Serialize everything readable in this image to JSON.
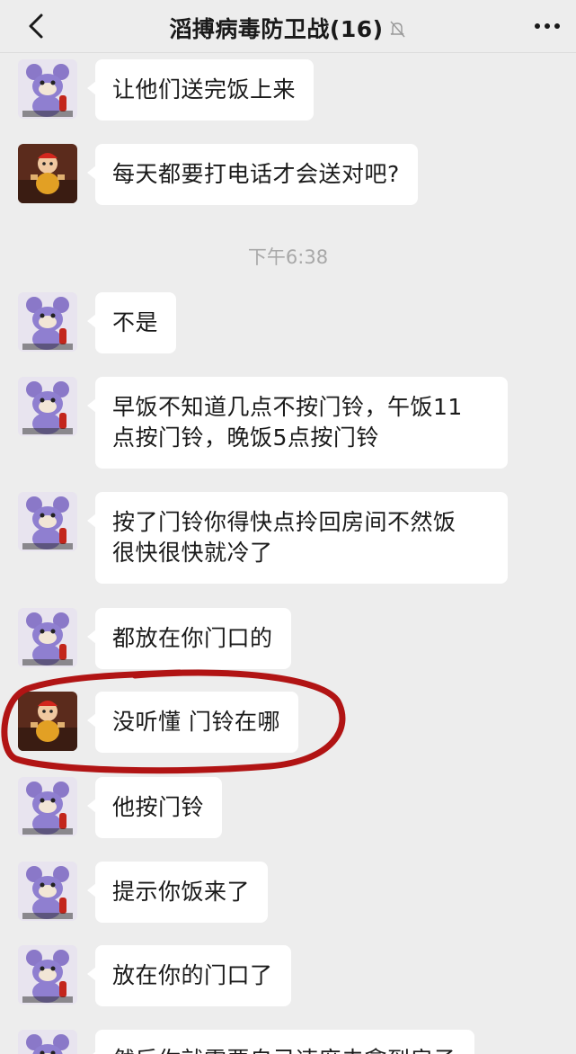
{
  "header": {
    "title": "滔搏病毒防卫战(16)",
    "back_icon": "chevron-left-icon",
    "mute_icon": "bell-off-icon",
    "more_icon": "more-dots-icon"
  },
  "colors": {
    "background": "#ededed",
    "bubble": "#ffffff",
    "annotation_circle": "#b11414"
  },
  "messages": [
    {
      "avatar": "blue-cartoon-avatar",
      "text": "让他们送完饭上来"
    },
    {
      "avatar": "red-cartoon-avatar",
      "text": "每天都要打电话才会送对吧?"
    },
    {
      "avatar": "blue-cartoon-avatar",
      "text": "不是"
    },
    {
      "avatar": "blue-cartoon-avatar",
      "text": "早饭不知道几点不按门铃，午饭11\n点按门铃，晚饭5点按门铃"
    },
    {
      "avatar": "blue-cartoon-avatar",
      "text": "按了门铃你得快点拎回房间不然饭\n很快很快就冷了"
    },
    {
      "avatar": "blue-cartoon-avatar",
      "text": "都放在你门口的"
    },
    {
      "avatar": "red-cartoon-avatar",
      "text": "没听懂 门铃在哪",
      "circled": true
    },
    {
      "avatar": "blue-cartoon-avatar",
      "text": "他按门铃"
    },
    {
      "avatar": "blue-cartoon-avatar",
      "text": "提示你饭来了"
    },
    {
      "avatar": "blue-cartoon-avatar",
      "text": "放在你的门口了"
    },
    {
      "avatar": "blue-cartoon-avatar",
      "text": "然后你就需要自己速度去拿到房子"
    }
  ],
  "timestamp": "下午6:38"
}
